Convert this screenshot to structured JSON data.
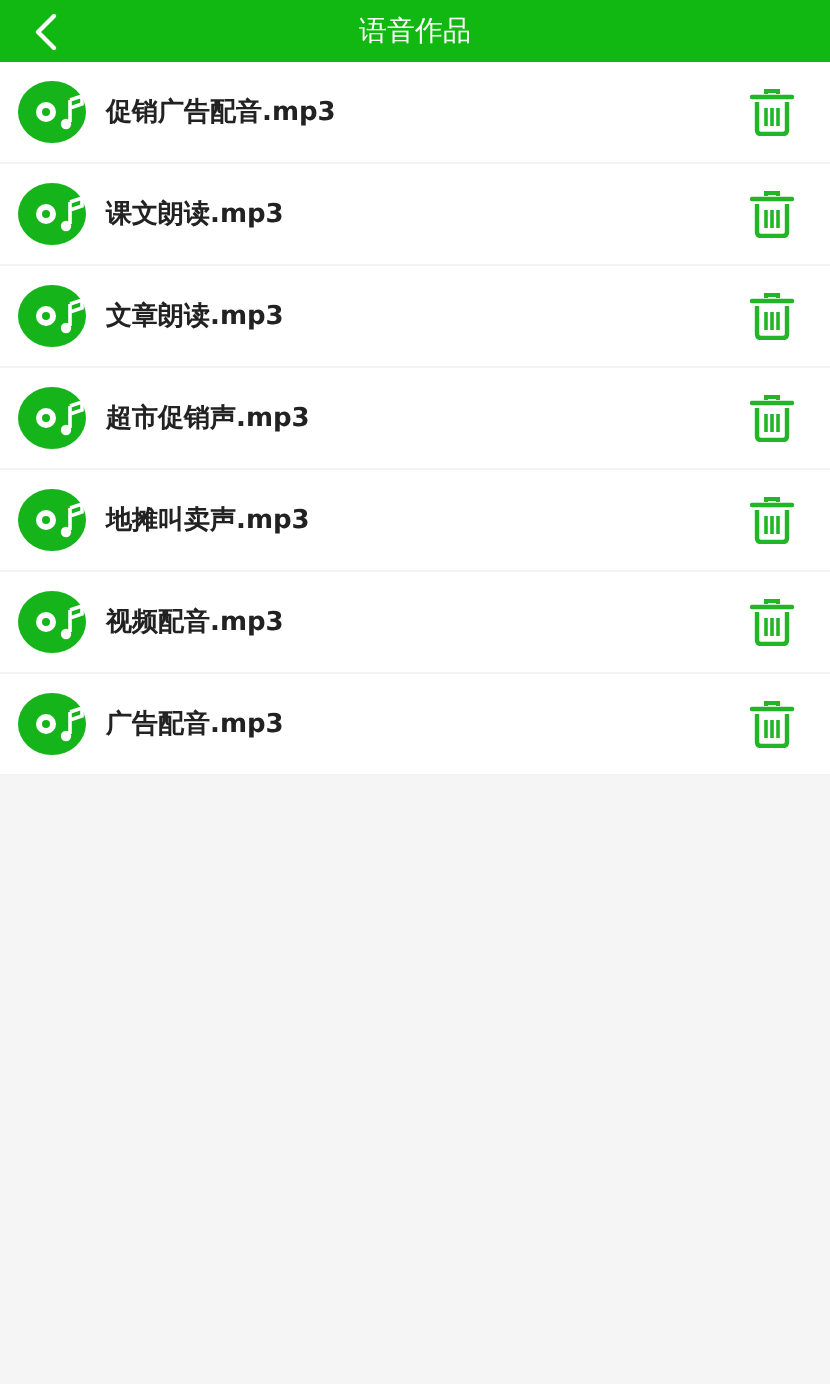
{
  "header": {
    "title": "语音作品"
  },
  "files": [
    {
      "name": "促销广告配音.mp3"
    },
    {
      "name": "课文朗读.mp3"
    },
    {
      "name": "文章朗读.mp3"
    },
    {
      "name": "超市促销声.mp3"
    },
    {
      "name": "地摊叫卖声.mp3"
    },
    {
      "name": "视频配音.mp3"
    },
    {
      "name": "广告配音.mp3"
    }
  ]
}
